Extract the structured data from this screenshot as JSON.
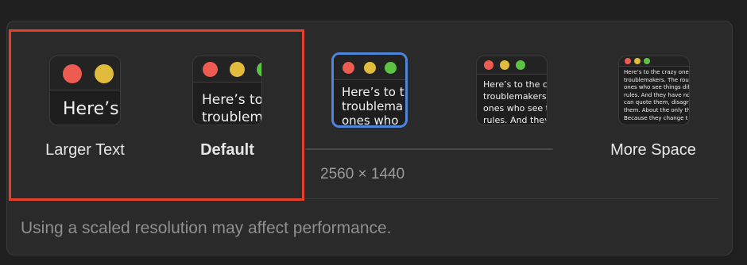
{
  "options": [
    {
      "label": "Larger Text",
      "preview": "Here’s",
      "selected": false
    },
    {
      "label": "Default",
      "preview": "Here’s to\ntroublem",
      "selected": false
    },
    {
      "label": "",
      "preview": "Here’s to t\ntroublema\nones who",
      "selected": true
    },
    {
      "label": "",
      "preview": "Here’s to the cr\ntroublemakers.\nones who see t\nrules. And they",
      "selected": false
    },
    {
      "label": "More Space",
      "preview": "Here’s to the crazy one\ntroublemakers. The rou\nones who see things dif\nrules. And they have no\ncan quote them, disagre\nthem. About the only th\nBecause they change t",
      "selected": false
    }
  ],
  "resolution": "2560 × 1440",
  "note": "Using a scaled resolution may affect performance.",
  "colors": {
    "close": "#ee5c51",
    "minimize": "#e0bb3c",
    "zoom": "#5dc343",
    "selection": "#4f86d9",
    "highlight": "#e6402a"
  }
}
